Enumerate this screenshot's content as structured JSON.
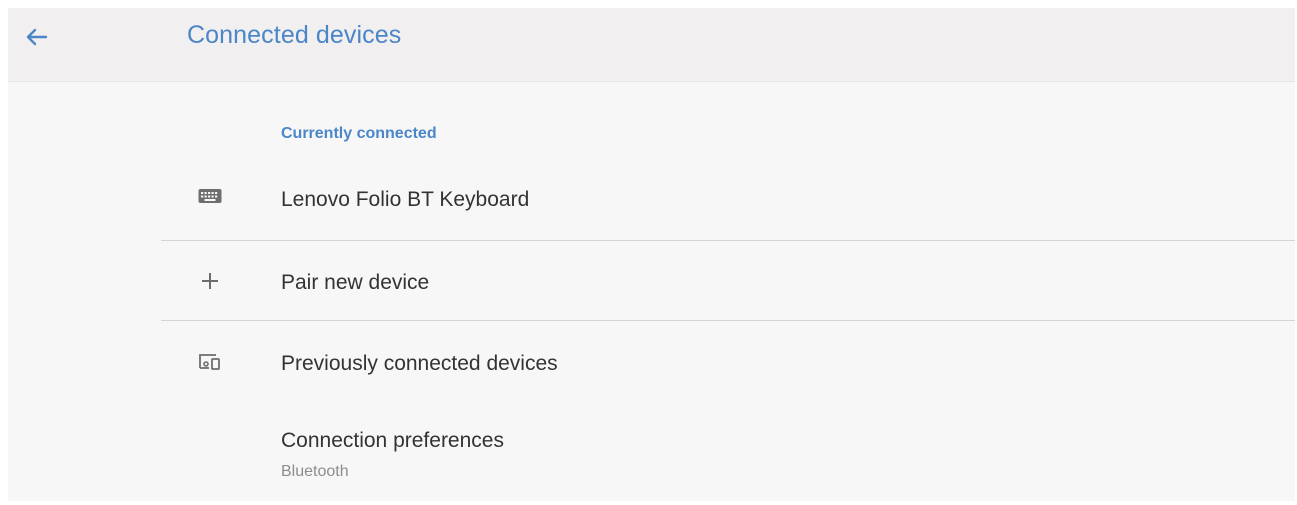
{
  "appbar": {
    "back_icon": "arrow-back-icon",
    "title": "Connected devices"
  },
  "colors": {
    "accent": "#4a86c8",
    "text_primary": "#333333",
    "text_secondary": "#8d8d8d",
    "background": "#f7f7f7",
    "appbar_background": "#f1efef"
  },
  "sections": {
    "currently_connected": {
      "header": "Currently connected",
      "device": {
        "icon": "keyboard-icon",
        "label": "Lenovo Folio BT Keyboard"
      }
    }
  },
  "items": {
    "pair_new": {
      "icon": "plus-icon",
      "label": "Pair new device"
    },
    "previously_connected": {
      "icon": "devices-icon",
      "label": "Previously connected devices"
    },
    "connection_preferences": {
      "label": "Connection preferences",
      "summary": "Bluetooth"
    }
  }
}
